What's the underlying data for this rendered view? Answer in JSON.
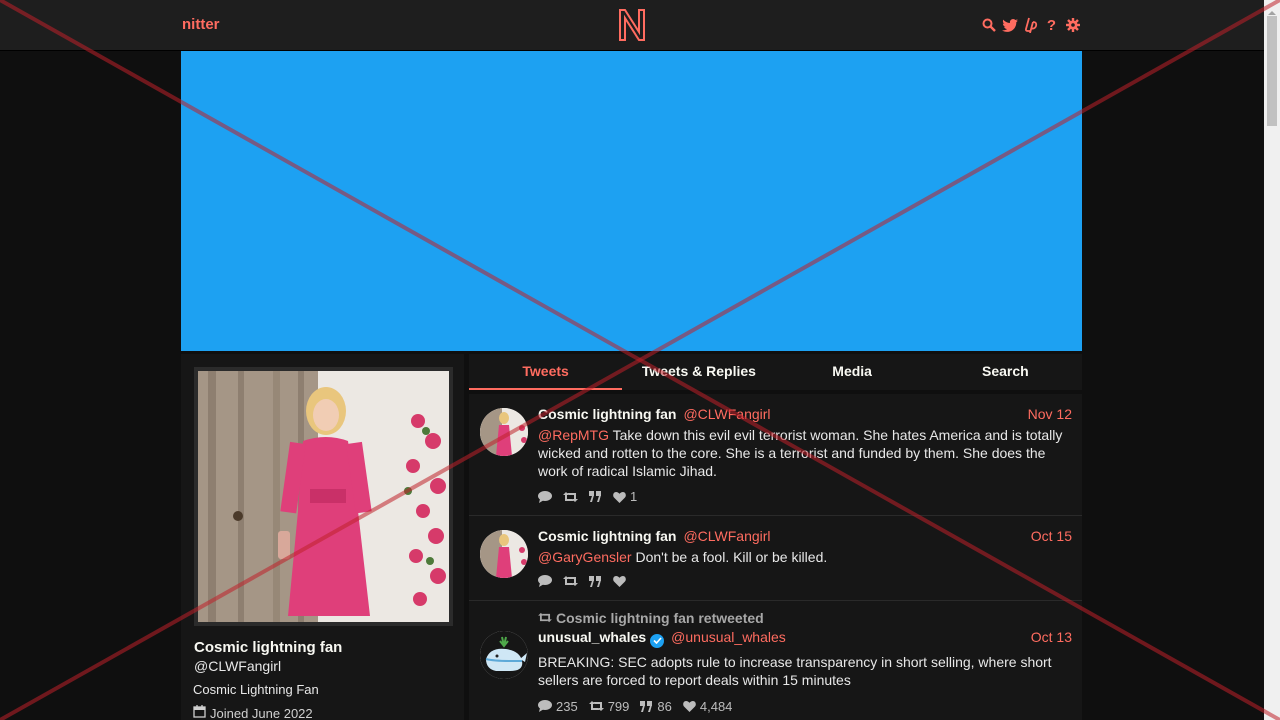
{
  "nav": {
    "logo": "nitter",
    "icons": [
      "search-icon",
      "twitter-icon",
      "liberapay-icon",
      "help-icon",
      "gear-icon"
    ],
    "accent": "#ff6c60"
  },
  "banner": {
    "color": "#1da1f2"
  },
  "profile": {
    "name": "Cosmic lightning fan",
    "handle": "@CLWFangirl",
    "bio": "Cosmic Lightning Fan",
    "joined": "Joined June 2022"
  },
  "tabs": [
    {
      "label": "Tweets",
      "active": true
    },
    {
      "label": "Tweets & Replies",
      "active": false
    },
    {
      "label": "Media",
      "active": false
    },
    {
      "label": "Search",
      "active": false
    }
  ],
  "tweets": [
    {
      "name": "Cosmic lightning fan",
      "handle": "@CLWFangirl",
      "date": "Nov 12",
      "mention": "@RepMTG",
      "text": " Take down this evil evil terrorist woman. She hates America and is totally wicked and rotten to the core. She is a terrorist and funded by them. She does the work of radical Islamic Jihad.",
      "likes": "1"
    },
    {
      "name": "Cosmic lightning fan",
      "handle": "@CLWFangirl",
      "date": "Oct 15",
      "mention": "@GaryGensler",
      "text": " Don't be a fool. Kill or be killed.",
      "likes": ""
    },
    {
      "retweet_label": "Cosmic lightning fan retweeted",
      "name": "unusual_whales",
      "handle": "@unusual_whales",
      "date": "Oct 13",
      "text": "BREAKING: SEC adopts rule to increase transparency in short selling, where short sellers are forced to report deals within 15 minutes",
      "comments": "235",
      "retweets": "799",
      "quotes": "86",
      "likes": "4,484"
    }
  ]
}
